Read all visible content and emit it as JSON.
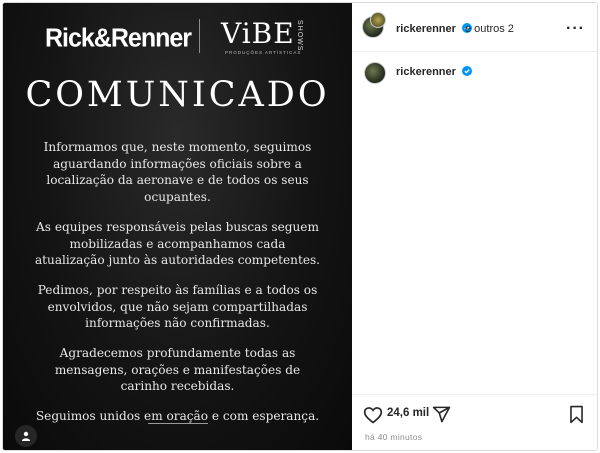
{
  "post": {
    "logos": {
      "rick_renner": "Rick&Renner",
      "vibe": "ViBE",
      "vibe_shows": "SHOWS",
      "vibe_subtitle": "PRODUÇÕES ARTÍSTICAS"
    },
    "headline": "COMUNICADO",
    "paragraphs": [
      "Informamos que, neste momento, seguimos aguardando informações oficiais sobre a localização da aeronave e de todos os seus ocupantes.",
      "As equipes responsáveis pelas buscas seguem mobilizadas e acompanhamos cada atualização junto às autoridades competentes.",
      "Pedimos, por respeito às famílias e a todos os envolvidos, que não sejam compartilhadas informações não confirmadas.",
      "Agradecemos profundamente todas as mensagens, orações e manifestações de carinho recebidas.",
      "Seguimos unidos em oração e com esperança."
    ]
  },
  "header": {
    "username": "rickerenner",
    "coauthors": "e outros 2",
    "more_icon": "more-horizontal-icon"
  },
  "caption": {
    "username": "rickerenner"
  },
  "actions": {
    "likes": "24,6 mil",
    "timestamp": "há 40 minutos",
    "icons": [
      "heart-icon",
      "share-icon",
      "bookmark-icon"
    ]
  },
  "colors": {
    "verified_blue": "#0095f6",
    "post_background": "#111111"
  }
}
